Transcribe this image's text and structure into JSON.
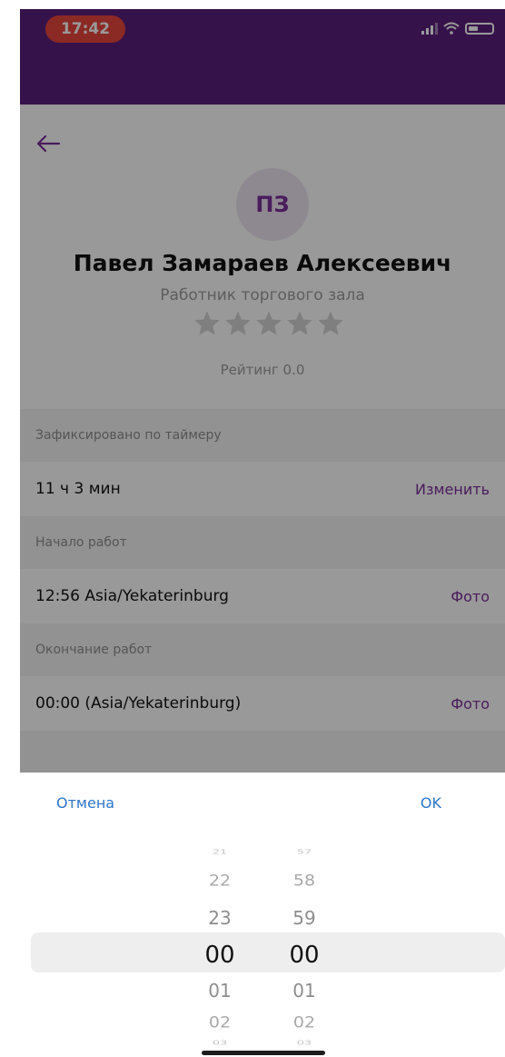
{
  "status_bar": {
    "time": "17:42"
  },
  "profile": {
    "initials": "ПЗ",
    "name": "Павел Замараев Алексеевич",
    "role": "Работник торгового зала",
    "rating_value": 0.0,
    "rating_max": 5,
    "rating_text": "Рейтинг 0.0"
  },
  "sections": [
    {
      "label": "Зафиксировано по таймеру",
      "value": "11 ч 3 мин",
      "action": "Изменить"
    },
    {
      "label": "Начало работ",
      "value": "12:56 Asia/Yekaterinburg",
      "action": "Фото"
    },
    {
      "label": "Окончание работ",
      "value": "00:00 (Asia/Yekaterinburg)",
      "action": "Фото"
    }
  ],
  "picker": {
    "cancel_label": "Отмена",
    "ok_label": "OK",
    "hours": [
      "21",
      "22",
      "23",
      "00",
      "01",
      "02",
      "03"
    ],
    "minutes": [
      "57",
      "58",
      "59",
      "00",
      "01",
      "02",
      "03"
    ],
    "selected_hour": "00",
    "selected_minute": "00"
  },
  "colors": {
    "header": "#5a1e7c",
    "accent": "#7a2f9a",
    "picker_button": "#2e75c7",
    "time_pill": "#e8453c"
  },
  "icons": {
    "back": "arrow-left-icon",
    "signal": "signal-icon",
    "wifi": "wifi-icon",
    "battery": "battery-icon",
    "star": "star-icon"
  }
}
